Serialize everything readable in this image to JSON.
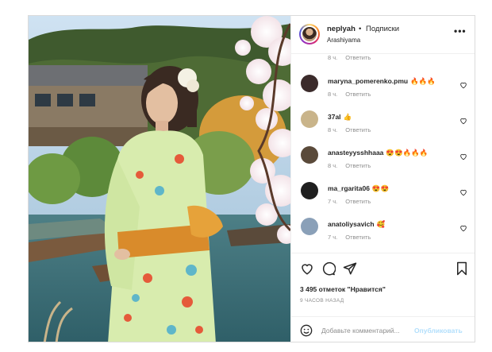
{
  "header": {
    "username": "neplyah",
    "separator": "•",
    "follow_label": "Подписки",
    "location": "Arashiyama",
    "more_icon": "more-horizontal-icon"
  },
  "comments": {
    "partial": {
      "time": "8 ч.",
      "reply": "Ответить"
    },
    "items": [
      {
        "username": "maryna_pomerenko.pmu",
        "text": "🔥🔥🔥",
        "time": "8 ч.",
        "reply": "Ответить",
        "avatar_color": "#3b2b2b"
      },
      {
        "username": "37al",
        "text": "👍",
        "time": "8 ч.",
        "reply": "Ответить",
        "avatar_color": "#c9b48a"
      },
      {
        "username": "anasteyysshhaaa",
        "text": "😍😍🔥🔥🔥",
        "time": "8 ч.",
        "reply": "Ответить",
        "avatar_color": "#5a4a3a"
      },
      {
        "username": "ma_rgarita06",
        "text": "😍😍",
        "time": "7 ч.",
        "reply": "Ответить",
        "avatar_color": "#1f1f1f"
      },
      {
        "username": "anatoliysavich",
        "text": "🥰",
        "time": "7 ч.",
        "reply": "Ответить",
        "avatar_color": "#8aa0b8"
      }
    ]
  },
  "actions": {
    "like_icon": "heart-icon",
    "comment_icon": "comment-icon",
    "share_icon": "paper-plane-icon",
    "save_icon": "bookmark-icon",
    "likes_text": "3 495 отметок \"Нравится\"",
    "time_ago": "9 ЧАСОВ НАЗАД"
  },
  "add_comment": {
    "placeholder": "Добавьте комментарий...",
    "publish_label": "Опубликовать",
    "emoji_icon": "smile-icon"
  },
  "colors": {
    "border": "#dbdbdb",
    "muted": "#8e8e8e",
    "publish_disabled": "#b2dffc"
  }
}
